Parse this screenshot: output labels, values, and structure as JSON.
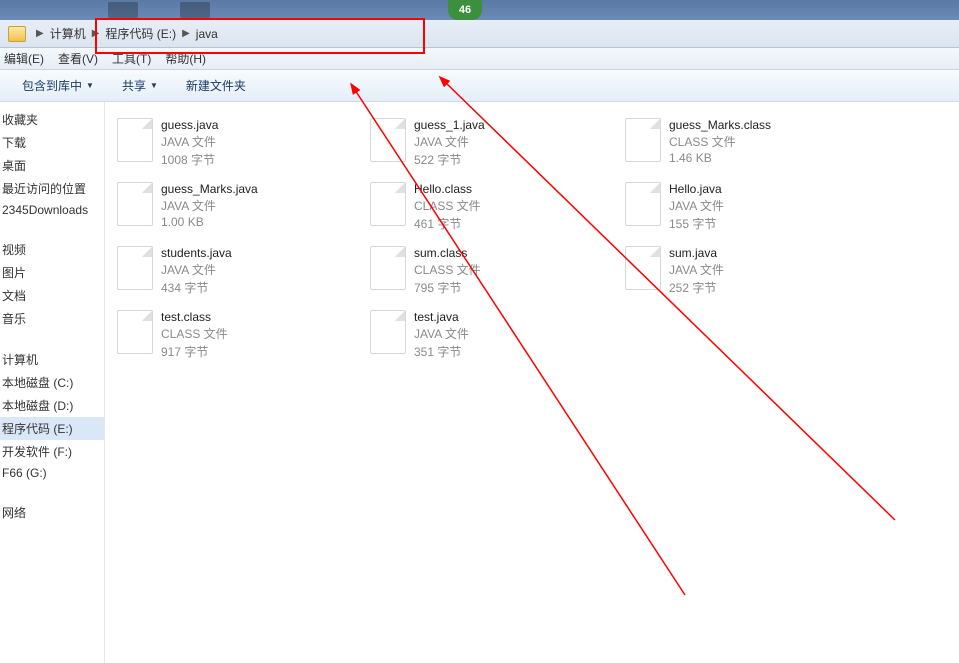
{
  "badge": "46",
  "breadcrumbs": [
    "计算机",
    "程序代码 (E:)",
    "java"
  ],
  "menu": {
    "edit": "编辑(E)",
    "view": "查看(V)",
    "tools": "工具(T)",
    "help": "帮助(H)"
  },
  "toolbar": {
    "include": "包含到库中",
    "share": "共享",
    "newfolder": "新建文件夹"
  },
  "sidebar": {
    "quick": [
      "收藏夹",
      "下载",
      "桌面",
      "最近访问的位置",
      "2345Downloads"
    ],
    "libs": [
      "视频",
      "图片",
      "文档",
      "音乐"
    ],
    "drives": [
      "计算机",
      "本地磁盘 (C:)",
      "本地磁盘 (D:)",
      "程序代码 (E:)",
      "开发软件 (F:)",
      "F66 (G:)"
    ],
    "net": [
      "网络"
    ]
  },
  "files": [
    {
      "name": "guess.java",
      "type": "JAVA 文件",
      "size": "1008 字节",
      "col": 0,
      "row": 0
    },
    {
      "name": "guess_1.java",
      "type": "JAVA 文件",
      "size": "522 字节",
      "col": 1,
      "row": 0
    },
    {
      "name": "guess_Marks.class",
      "type": "CLASS 文件",
      "size": "1.46 KB",
      "col": 2,
      "row": 0
    },
    {
      "name": "guess_Marks.java",
      "type": "JAVA 文件",
      "size": "1.00 KB",
      "col": 0,
      "row": 1
    },
    {
      "name": "Hello.class",
      "type": "CLASS 文件",
      "size": "461 字节",
      "col": 1,
      "row": 1
    },
    {
      "name": "Hello.java",
      "type": "JAVA 文件",
      "size": "155 字节",
      "col": 2,
      "row": 1
    },
    {
      "name": "students.java",
      "type": "JAVA 文件",
      "size": "434 字节",
      "col": 0,
      "row": 2
    },
    {
      "name": "sum.class",
      "type": "CLASS 文件",
      "size": "795 字节",
      "col": 1,
      "row": 2
    },
    {
      "name": "sum.java",
      "type": "JAVA 文件",
      "size": "252 字节",
      "col": 2,
      "row": 2
    },
    {
      "name": "test.class",
      "type": "CLASS 文件",
      "size": "917 字节",
      "col": 0,
      "row": 3
    },
    {
      "name": "test.java",
      "type": "JAVA 文件",
      "size": "351 字节",
      "col": 1,
      "row": 3
    }
  ]
}
